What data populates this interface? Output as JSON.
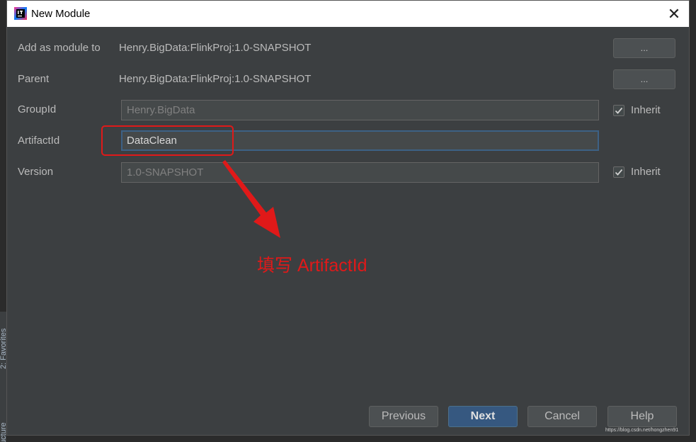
{
  "window": {
    "title": "New Module",
    "close_glyph": "✕"
  },
  "form": {
    "add_as_module_to": {
      "label": "Add as module to",
      "value": "Henry.BigData:FlinkProj:1.0-SNAPSHOT",
      "button": "..."
    },
    "parent": {
      "label": "Parent",
      "value": "Henry.BigData:FlinkProj:1.0-SNAPSHOT",
      "button": "..."
    },
    "group_id": {
      "label": "GroupId",
      "value": "Henry.BigData",
      "inherit_label": "Inherit",
      "inherit_checked": true
    },
    "artifact_id": {
      "label": "ArtifactId",
      "value": "DataClean"
    },
    "version": {
      "label": "Version",
      "value": "1.0-SNAPSHOT",
      "inherit_label": "Inherit",
      "inherit_checked": true
    }
  },
  "annotation": {
    "text": "填写 ArtifactId",
    "color": "#e01919"
  },
  "footer": {
    "previous_label": "Previous",
    "next_label": "Next",
    "cancel_label": "Cancel",
    "help_label": "Help"
  },
  "sidebar": {
    "favorites_label": "2: Favorites",
    "structure_label": "Structure"
  },
  "watermark": "https://blog.csdn.net/hongzhen91",
  "colors": {
    "dialog_bg": "#3c3f41",
    "accent": "#365880",
    "field_focus_border": "#3d6185"
  }
}
